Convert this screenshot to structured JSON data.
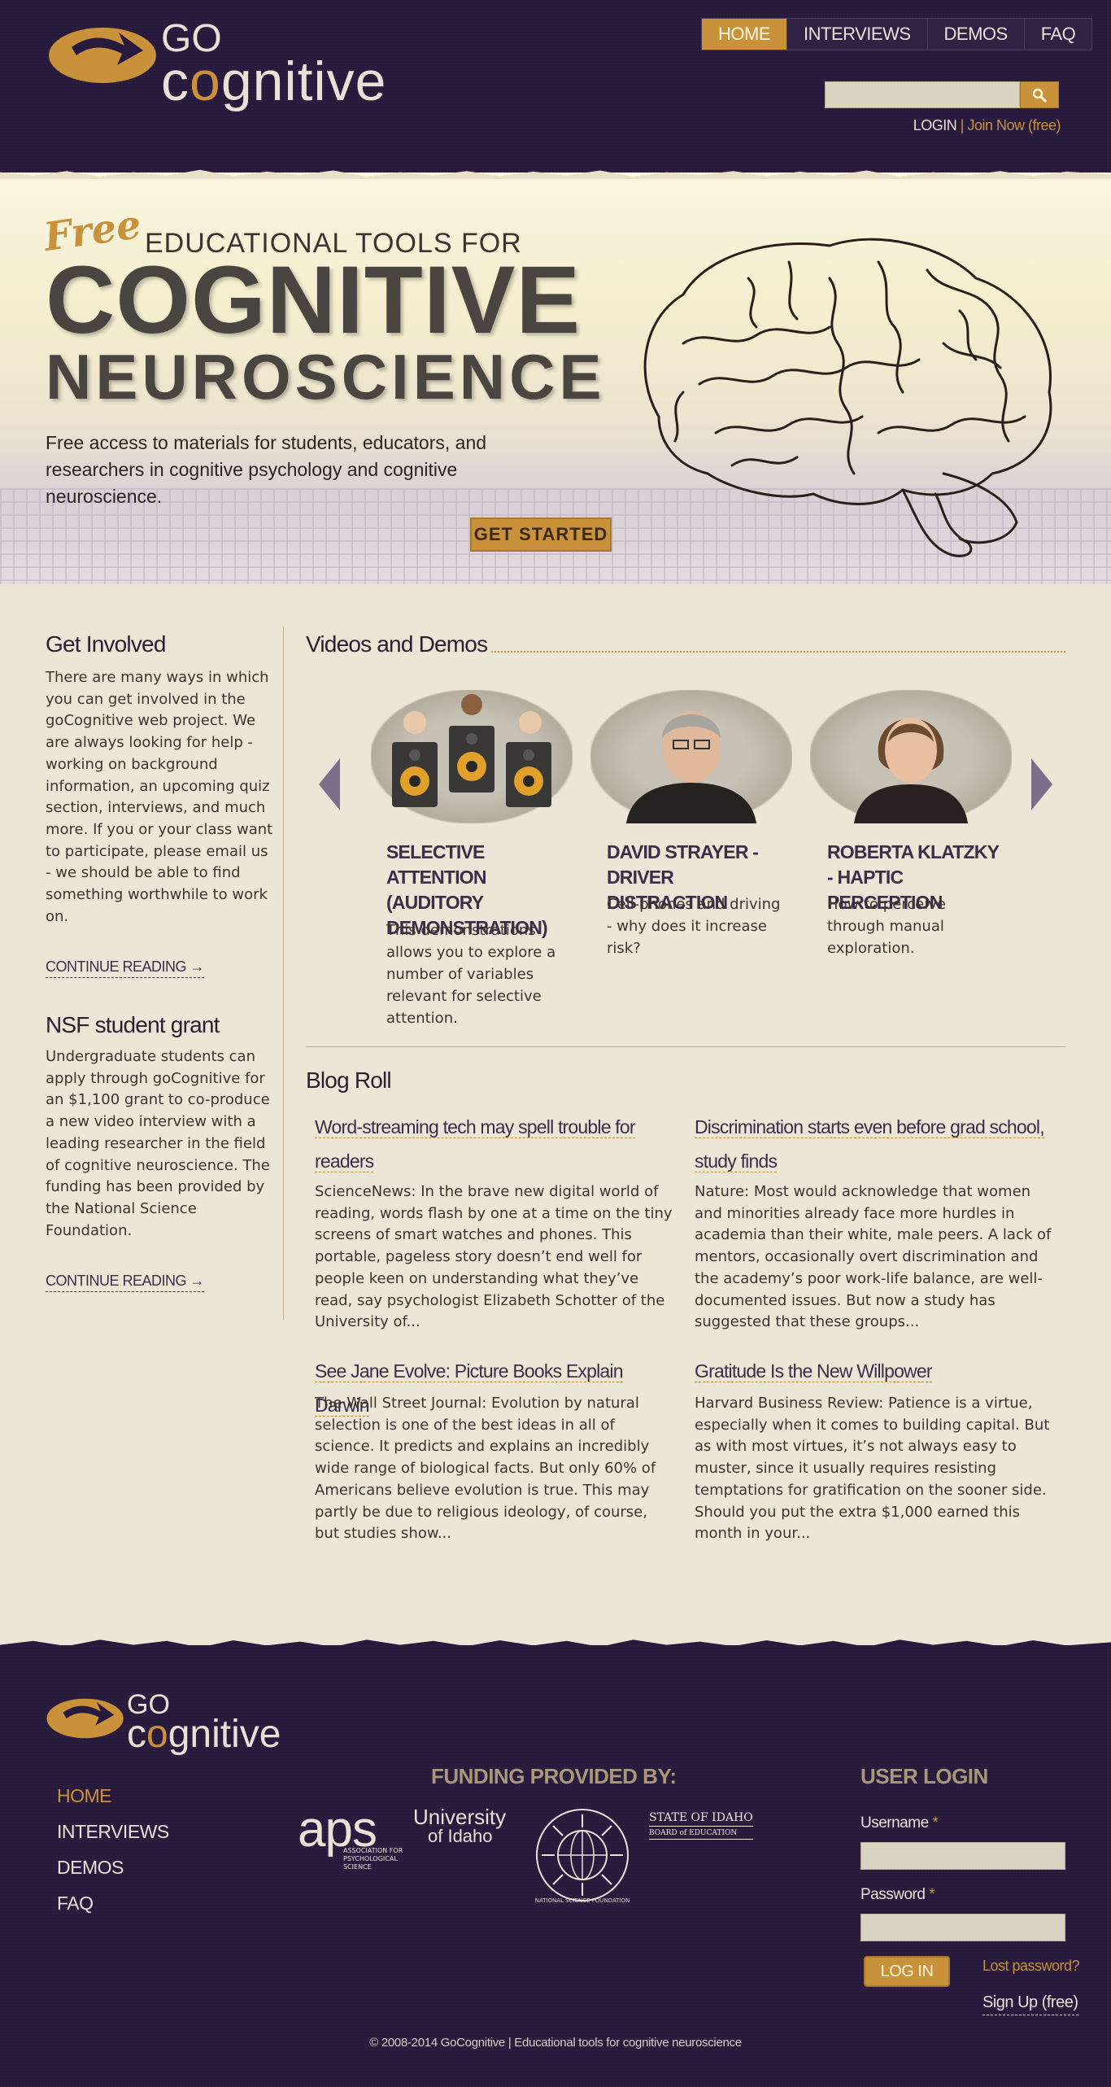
{
  "header": {
    "logo": {
      "go": "GO",
      "cognitive_pre": "c",
      "cognitive_o": "o",
      "cognitive_post": "gnitive"
    },
    "nav": [
      {
        "label": "HOME",
        "active": true
      },
      {
        "label": "INTERVIEWS",
        "active": false
      },
      {
        "label": "DEMOS",
        "active": false
      },
      {
        "label": "FAQ",
        "active": false
      }
    ],
    "search": {
      "placeholder": "",
      "icon": "search-icon"
    },
    "login": "LOGIN",
    "separator": "|",
    "join": "Join Now (free)"
  },
  "hero": {
    "free": "Free",
    "tools": "EDUCATIONAL TOOLS FOR",
    "title_line1": "COGNITIVE",
    "title_line2": "NEUROSCIENCE",
    "description": "Free access to materials for students, educators, and researchers in cognitive psychology and cognitive neuroscience.",
    "cta": "GET STARTED"
  },
  "sidebar": {
    "get_involved": {
      "heading": "Get Involved",
      "text": "There are many ways in which you can get involved in the goCognitive web project. We are always looking for help - working on background information, an upcoming quiz section, interviews, and much more. If you or your class want to participate, please email us - we should be able to find something worthwhile to work on.",
      "link": "CONTINUE READING →"
    },
    "nsf": {
      "heading": "NSF student grant",
      "text": "Undergraduate students can apply through goCognitive for an $1,100 grant to co-produce a new video interview with a leading researcher in the field of cognitive neuroscience. The funding has been provided by the National Science Foundation.",
      "link": "CONTINUE READING →"
    }
  },
  "videos": {
    "heading": "Videos and Demos",
    "items": [
      {
        "title": "SELECTIVE ATTENTION (AUDITORY DEMONSTRATION)",
        "desc": "This demonstrations allows you to explore a number of variables relevant for selective attention."
      },
      {
        "title": "DAVID STRAYER - DRIVER DISTRACTION",
        "desc": "Cell-phones and driving - why does it increase risk?"
      },
      {
        "title": "ROBERTA KLATZKY - HAPTIC PERCEPTION",
        "desc": "How to perceive through manual exploration."
      }
    ]
  },
  "blog": {
    "heading": "Blog Roll",
    "posts": [
      {
        "title": "Word-streaming tech may spell trouble for readers",
        "desc": "ScienceNews: In the brave new digital world of reading, words flash by one at a time on the tiny screens of smart watches and phones. This portable, pageless story doesn’t end well for people keen on understanding what they’ve read, say psychologist Elizabeth Schotter of the University of..."
      },
      {
        "title": "Discrimination starts even before grad school, study finds",
        "desc": "Nature: Most would acknowledge that women and minorities already face more hurdles in academia than their white, male peers. A lack of mentors, occasionally overt discrimination and the academy’s poor work-life balance, are well-documented issues. But now a study has suggested that these groups..."
      },
      {
        "title": "See Jane Evolve: Picture Books Explain Darwin",
        "desc": "The Wall Street Journal: Evolution by natural selection is one of the best ideas in all of science. It predicts and explains an incredibly wide range of biological facts. But only 60% of Americans believe evolution is true. This may partly be due to religious ideology, of course, but studies show..."
      },
      {
        "title": "Gratitude Is the New Willpower",
        "desc": "Harvard Business Review: Patience is a virtue, especially when it comes to building capital. But as with most virtues, it’s not always easy to muster, since it usually requires resisting temptations for gratification on the sooner side. Should you put the extra $1,000 earned this month in your..."
      }
    ]
  },
  "footer": {
    "nav": [
      {
        "label": "HOME",
        "active": true
      },
      {
        "label": "INTERVIEWS",
        "active": false
      },
      {
        "label": "DEMOS",
        "active": false
      },
      {
        "label": "FAQ",
        "active": false
      }
    ],
    "funding_heading": "FUNDING PROVIDED BY:",
    "sponsors": {
      "aps": "aps",
      "aps_sub1": "ASSOCIATION FOR",
      "aps_sub2": "PSYCHOLOGICAL SCIENCE",
      "uidaho1": "University",
      "uidaho2": "of Idaho",
      "nsf": "NATIONAL SCIENCE FOUNDATION",
      "idaho_board1": "STATE OF IDAHO",
      "idaho_board2": "BOARD of EDUCATION"
    },
    "login_heading": "USER LOGIN",
    "username_label": "Username",
    "password_label": "Password",
    "required": "*",
    "login_button": "LOG IN",
    "lost_password": "Lost password?",
    "signup": "Sign Up (free)",
    "copyright": "© 2008-2014 GoCognitive | Educational tools for cognitive neuroscience"
  },
  "colors": {
    "primary": "#271a3c",
    "accent": "#c8913a",
    "background": "#ece6d6"
  }
}
